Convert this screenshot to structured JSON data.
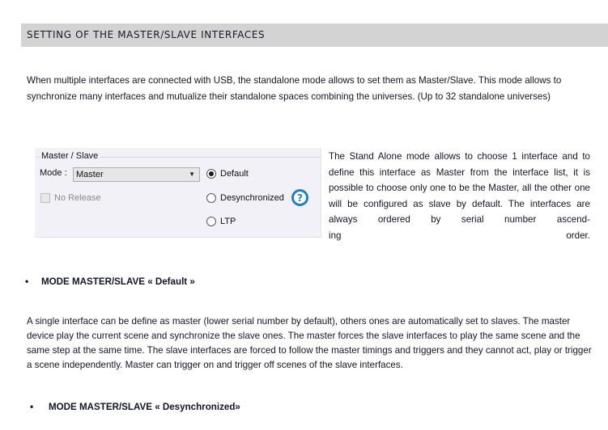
{
  "section": {
    "title": "SETTING OF THE MASTER/SLAVE INTERFACES"
  },
  "intro_text": "When multiple interfaces are connected with USB, the standalone mode allows to set them as Master/Slave.  This mode allows to synchronize many interfaces and mutualize their standalone spaces combining the universes. (Up to 32 standalone universes)",
  "panel": {
    "group_title": "Master / Slave",
    "mode_label": "Mode :",
    "mode_value": "Master",
    "no_release_label": "No Release",
    "no_release_checked": false,
    "radios": [
      {
        "label": "Default",
        "checked": true
      },
      {
        "label": "Desynchronized",
        "checked": false
      },
      {
        "label": "LTP",
        "checked": false
      }
    ],
    "help_symbol": "?"
  },
  "side_text": "The Stand Alone mode allows to choose 1 interface and to define this interface as Master from the interface list, it is possible to choose only one to be the Master, all the other one will be configured as slave by default. The interfaces are always ordered by serial number ascend-",
  "side_text_last": "ing order.",
  "bullets": [
    {
      "symbol": "•",
      "label": "MODE MASTER/SLAVE « Default »"
    },
    {
      "symbol": "•",
      "label": "MODE MASTER/SLAVE  « Desynchronized»"
    }
  ],
  "default_description": "A single interface can be define as master (lower serial number by default), others ones are automatically set to slaves. The master device play the current scene and synchronize the slave ones. The master forces the slave interfaces to play the same scene and the same step at the same time. The slave interfaces are forced to follow the master timings and triggers and they cannot act, play or trigger a scene independently. Master can trigger on and trigger off scenes of the slave interfaces."
}
